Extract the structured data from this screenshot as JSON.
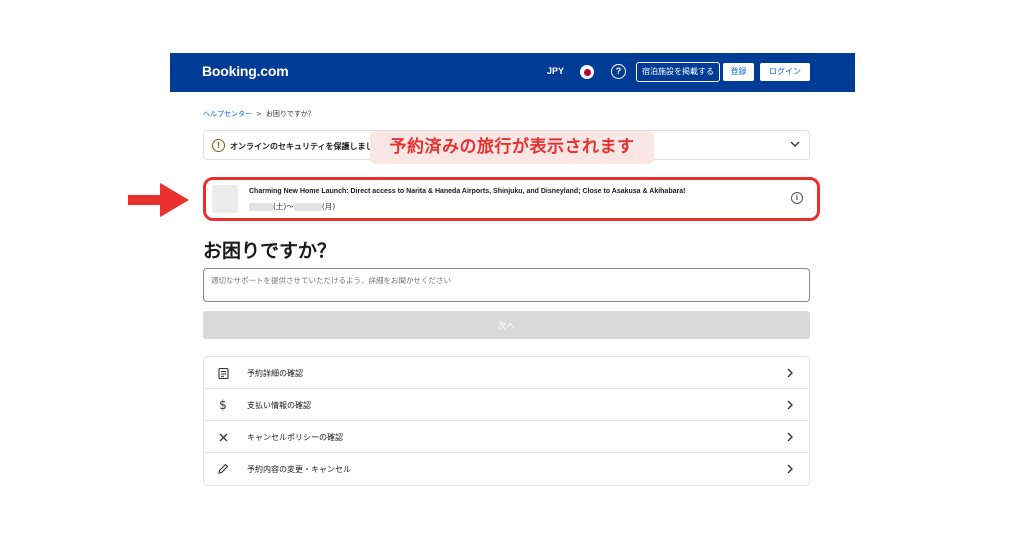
{
  "header": {
    "logo": "Booking.com",
    "currency": "JPY",
    "help_symbol": "?",
    "list_property": "宿泊施設を掲載する",
    "register": "登録",
    "login": "ログイン"
  },
  "breadcrumb": {
    "home": "ヘルプセンター",
    "separator": ">",
    "current": "お困りですか？"
  },
  "security_banner": {
    "text": "オンラインのセキュリティを保護しまし"
  },
  "callout": {
    "text": "予約済みの旅行が表示されます"
  },
  "booking": {
    "title": "Charming New Home Launch: Direct access to Narita & Haneda Airports, Shinjuku, and Disneyland; Close to Asakusa & Akihabara!",
    "checkin_day": "(土)〜",
    "checkout_day": "(月)"
  },
  "main": {
    "heading": "お困りですか？",
    "textarea_placeholder": "適切なサポートを提供させていただけるよう、詳細をお聞かせください",
    "next_button": "次へ"
  },
  "options": [
    {
      "label": "予約詳細の確認",
      "icon": "receipt-icon"
    },
    {
      "label": "支払い情報の確認",
      "icon": "dollar-icon"
    },
    {
      "label": "キャンセルポリシーの確認",
      "icon": "x-icon"
    },
    {
      "label": "予約内容の変更・キャンセル",
      "icon": "pencil-icon"
    }
  ],
  "colors": {
    "brand_blue": "#003b95",
    "link_blue": "#006ce4",
    "highlight_red": "#e8312f"
  }
}
